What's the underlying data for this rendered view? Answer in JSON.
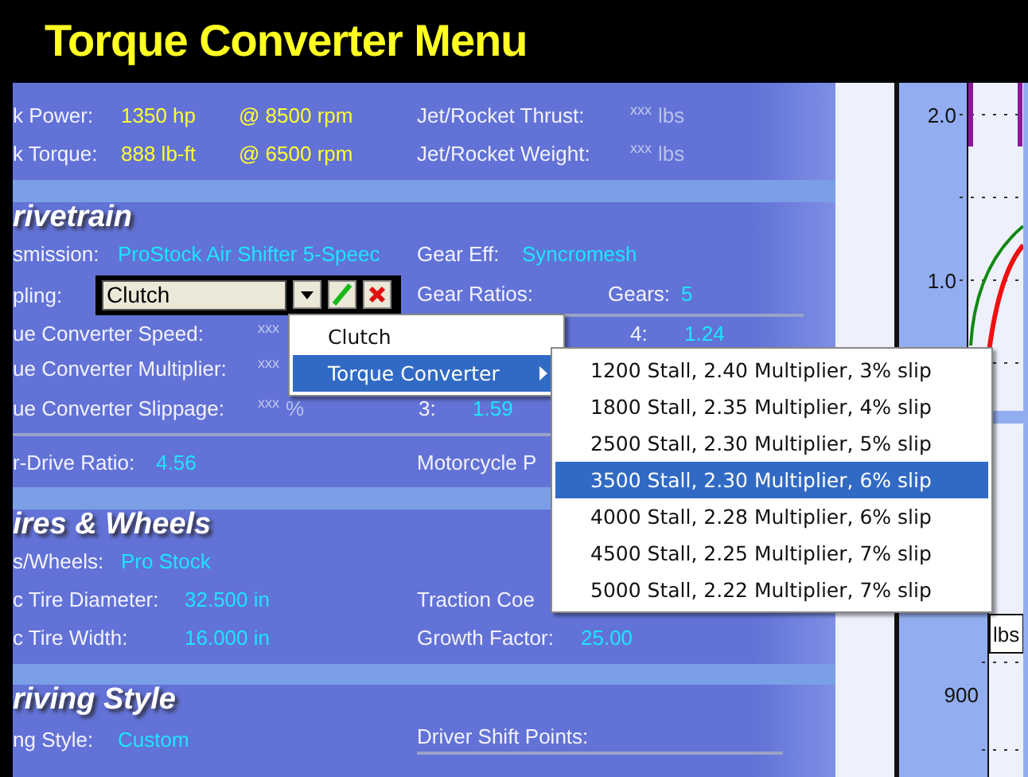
{
  "title": "Torque Converter Menu",
  "engine": {
    "rows": [
      {
        "label": "k Power:",
        "value": "1350 hp",
        "at": "@ 8500 rpm"
      },
      {
        "label": "k Torque:",
        "value": "888 lb-ft",
        "at": "@ 6500 rpm"
      }
    ],
    "jet_rocket": [
      {
        "label": "Jet/Rocket Thrust:",
        "value": "xxx",
        "unit": "lbs"
      },
      {
        "label": "Jet/Rocket Weight:",
        "value": "xxx",
        "unit": "lbs"
      }
    ]
  },
  "drivetrain": {
    "heading": "rivetrain",
    "transmission": {
      "label": "smission:",
      "value": "ProStock Air Shifter 5-Speec"
    },
    "gear_eff": {
      "label": "Gear Eff:",
      "value": "Syncromesh"
    },
    "coupling": {
      "label": "pling:",
      "value": "Clutch"
    },
    "gear_ratios": {
      "label": "Gear Ratios:",
      "gears_label": "Gears:",
      "gears": "5"
    },
    "converter_fields": [
      {
        "label": "ue Converter Speed:",
        "value": "xxx"
      },
      {
        "label": "ue Converter Multiplier:",
        "value": "xxx"
      },
      {
        "label": "ue Converter Slippage:",
        "value": "xxx",
        "unit": "%"
      }
    ],
    "ratios": [
      {
        "gear": "4:",
        "value": "1.24"
      },
      {
        "gear": "3:",
        "value": "1.59"
      }
    ],
    "final_drive": {
      "label": "r-Drive Ratio:",
      "value": "4.56"
    },
    "motorcycle": "Motorcycle P"
  },
  "tires": {
    "heading": "ires & Wheels",
    "tires_wheels": {
      "label": "s/Wheels:",
      "value": "Pro Stock"
    },
    "diameter": {
      "label": "c Tire Diameter:",
      "value": "32.500 in"
    },
    "width": {
      "label": "c Tire Width:",
      "value": "16.000 in"
    },
    "traction": "Traction Coe",
    "growth": {
      "label": "Growth Factor:",
      "value": "25.00"
    }
  },
  "driving": {
    "heading": "riving Style",
    "style": {
      "label": "ng Style:",
      "value": "Custom"
    },
    "shift_points": "Driver Shift Points:"
  },
  "coupling_menu": {
    "items": [
      {
        "label": "Clutch",
        "selected": false,
        "submenu": false
      },
      {
        "label": "Torque Converter",
        "selected": true,
        "submenu": true
      }
    ]
  },
  "converter_menu": {
    "items": [
      {
        "label": "1200 Stall, 2.40 Multiplier, 3% slip",
        "selected": false
      },
      {
        "label": "1800 Stall, 2.35 Multiplier, 4% slip",
        "selected": false
      },
      {
        "label": "2500 Stall, 2.30 Multiplier, 5% slip",
        "selected": false
      },
      {
        "label": "3500 Stall, 2.30 Multiplier, 6% slip",
        "selected": true
      },
      {
        "label": "4000 Stall, 2.28 Multiplier, 6% slip",
        "selected": false
      },
      {
        "label": "4500 Stall, 2.25 Multiplier, 7% slip",
        "selected": false
      },
      {
        "label": "5000 Stall, 2.22 Multiplier, 7% slip",
        "selected": false
      }
    ]
  },
  "charts": {
    "top_ticks": [
      "2.0",
      "1.0"
    ],
    "bottom_ticks": [
      "900"
    ],
    "bottom_unit": "lbs"
  }
}
